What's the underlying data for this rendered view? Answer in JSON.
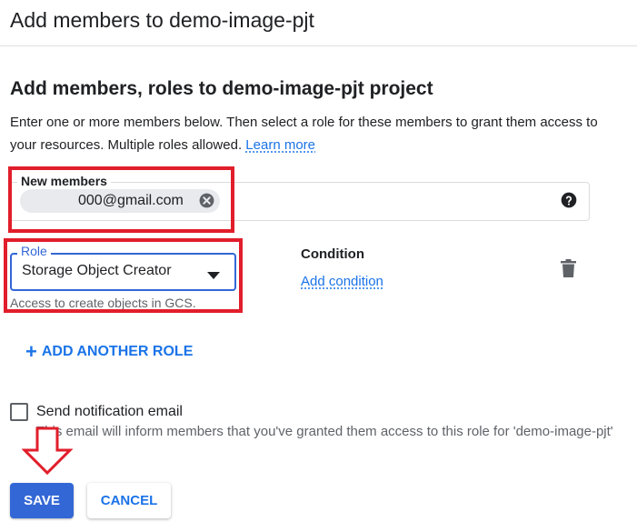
{
  "dialog": {
    "title": "Add members to demo-image-pjt"
  },
  "section": {
    "heading": "Add members, roles to demo-image-pjt project",
    "description": "Enter one or more members below. Then select a role for these members to grant them access to your resources. Multiple roles allowed.",
    "learn_more": "Learn more"
  },
  "members": {
    "label": "New members",
    "chip_text": "000@gmail.com",
    "remove_icon": "cancel-circle-icon",
    "help_icon": "help-circle-icon"
  },
  "role": {
    "label": "Role",
    "value": "Storage Object Creator",
    "hint": "Access to create objects in GCS.",
    "dropdown_icon": "arrow-drop-down-icon"
  },
  "condition": {
    "label": "Condition",
    "add_link": "Add condition",
    "delete_icon": "trash-icon"
  },
  "add_role": {
    "label": "ADD ANOTHER ROLE",
    "icon": "plus-icon"
  },
  "notification": {
    "checked": false,
    "label": "Send notification email",
    "hint": "This email will inform members that you've granted them access to this role for 'demo-image-pjt'"
  },
  "actions": {
    "save": "SAVE",
    "cancel": "CANCEL"
  },
  "colors": {
    "primary": "#3367d6",
    "link": "#1a73e8",
    "annotation_red": "#e11e2b"
  }
}
